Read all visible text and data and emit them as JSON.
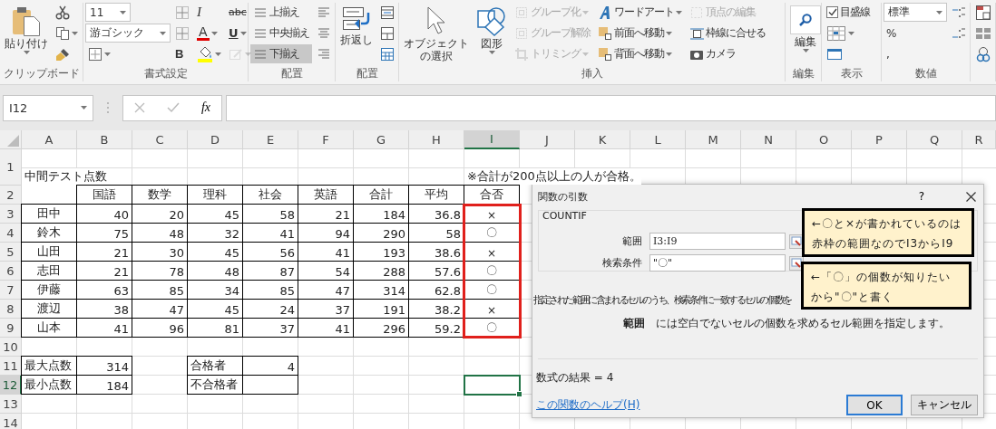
{
  "ribbon": {
    "groups": [
      {
        "label": "クリップボード",
        "columns": [
          [
            {
              "kind": "big",
              "text": "貼り付け"
            }
          ],
          [
            {
              "kind": "icon"
            },
            {
              "kind": "icon"
            },
            {
              "kind": "icon"
            }
          ]
        ]
      },
      {
        "label": "書式設定",
        "columns": [
          [
            {
              "kind": "combo",
              "text": "11"
            },
            {
              "kind": "combo",
              "text": "游ゴシック"
            },
            {
              "kind": "icon"
            }
          ],
          [
            {
              "kind": "icon"
            },
            {
              "kind": "icon"
            },
            {
              "kind": "glyph",
              "text": "B"
            }
          ],
          [
            {
              "kind": "glyph",
              "text": "I"
            },
            {
              "kind": "glyph",
              "text": "A"
            },
            {
              "kind": "icon"
            }
          ],
          [
            {
              "kind": "glyph",
              "text": "abc",
              "disabled": false
            },
            {
              "kind": "glyph",
              "text": "U",
              "disabled": false
            },
            {
              "kind": "icon",
              "disabled": true
            }
          ]
        ]
      },
      {
        "label": "配置",
        "columns": [
          [
            {
              "kind": "small",
              "text": "上揃え",
              "selected": false
            },
            {
              "kind": "small",
              "text": "中央揃え",
              "selected": false
            },
            {
              "kind": "small",
              "text": "下揃え",
              "selected": true
            }
          ],
          [
            {
              "kind": "icon"
            },
            {
              "kind": "icon"
            },
            {
              "kind": "icon"
            }
          ]
        ]
      },
      {
        "label": "配置",
        "columns": [
          [
            {
              "kind": "big",
              "text": "折返し"
            }
          ],
          [
            {
              "kind": "icon"
            },
            {
              "kind": "icon"
            },
            {
              "kind": "icon"
            }
          ]
        ]
      },
      {
        "label": "挿入",
        "columns": [
          [
            {
              "kind": "big",
              "text": "オブジェクトの選択"
            }
          ],
          [
            {
              "kind": "big",
              "text": "図形"
            }
          ],
          [
            {
              "kind": "small",
              "text": "グループ化",
              "disabled": true
            },
            {
              "kind": "small",
              "text": "グループ解除",
              "disabled": true
            },
            {
              "kind": "small",
              "text": "トリミング",
              "disabled": true
            }
          ],
          [
            {
              "kind": "small",
              "text": "ワードアート",
              "disabled": false
            },
            {
              "kind": "small",
              "text": "前面へ移動",
              "disabled": false
            },
            {
              "kind": "small",
              "text": "背面へ移動",
              "disabled": false
            }
          ],
          [
            {
              "kind": "small",
              "text": "頂点の編集",
              "disabled": true
            },
            {
              "kind": "small",
              "text": "枠線に合せる",
              "disabled": false
            },
            {
              "kind": "small",
              "text": "カメラ",
              "disabled": false
            }
          ]
        ]
      },
      {
        "label": "編集",
        "columns": [
          [
            {
              "kind": "big",
              "text": "編集"
            }
          ]
        ]
      },
      {
        "label": "表示",
        "columns": [
          [
            {
              "kind": "check",
              "text": "目盛線",
              "checked": true
            },
            {
              "kind": "icon"
            },
            {
              "kind": "icon"
            }
          ]
        ]
      },
      {
        "label": "数値",
        "columns": [
          [
            {
              "kind": "combo",
              "text": "標準"
            },
            {
              "kind": "glyph",
              "text": "%"
            },
            {
              "kind": "glyph",
              "text": ","
            }
          ],
          [
            {
              "kind": "icon"
            },
            {
              "kind": "icon"
            }
          ]
        ]
      },
      {
        "columns": [
          [
            {
              "kind": "icon"
            },
            {
              "kind": "icon"
            },
            {
              "kind": "icon"
            }
          ]
        ]
      }
    ]
  },
  "formula_bar": {
    "name_box": "I12",
    "fx": "fx"
  },
  "sheet": {
    "columns": [
      {
        "label": "A",
        "selected": false
      },
      {
        "label": "B",
        "selected": false
      },
      {
        "label": "C",
        "selected": false
      },
      {
        "label": "D",
        "selected": false
      },
      {
        "label": "E",
        "selected": false
      },
      {
        "label": "F",
        "selected": false
      },
      {
        "label": "G",
        "selected": false
      },
      {
        "label": "H",
        "selected": false
      },
      {
        "label": "I",
        "selected": true
      },
      {
        "label": "J",
        "selected": false
      },
      {
        "label": "K",
        "selected": false
      },
      {
        "label": "L",
        "selected": false
      },
      {
        "label": "M",
        "selected": false
      },
      {
        "label": "N",
        "selected": false
      },
      {
        "label": "O",
        "selected": false
      },
      {
        "label": "P",
        "selected": false
      },
      {
        "label": "Q",
        "selected": false
      },
      {
        "label": "R",
        "selected": false
      }
    ],
    "rows": [
      {
        "label": "1",
        "selected": false
      },
      {
        "label": "2",
        "selected": false
      },
      {
        "label": "3",
        "selected": false
      },
      {
        "label": "4",
        "selected": false
      },
      {
        "label": "5",
        "selected": false
      },
      {
        "label": "6",
        "selected": false
      },
      {
        "label": "7",
        "selected": false
      },
      {
        "label": "8",
        "selected": false
      },
      {
        "label": "9",
        "selected": false
      },
      {
        "label": "10",
        "selected": false
      },
      {
        "label": "11",
        "selected": false
      },
      {
        "label": "12",
        "selected": true
      },
      {
        "label": "13",
        "selected": false
      },
      {
        "label": "14",
        "selected": false
      }
    ],
    "title": "中間テスト点数",
    "note": "※合計が200点以上の人が合格。",
    "score_table": {
      "headers": [
        "国語",
        "数学",
        "理科",
        "社会",
        "英語",
        "合計",
        "平均",
        "合否"
      ],
      "rows": [
        {
          "name": "田中",
          "values": [
            "40",
            "20",
            "45",
            "58",
            "21",
            "184",
            "36.8"
          ],
          "result": "×"
        },
        {
          "name": "鈴木",
          "values": [
            "75",
            "48",
            "32",
            "41",
            "94",
            "290",
            "58"
          ],
          "result": "〇"
        },
        {
          "name": "山田",
          "values": [
            "21",
            "30",
            "45",
            "56",
            "41",
            "193",
            "38.6"
          ],
          "result": "×"
        },
        {
          "name": "志田",
          "values": [
            "21",
            "78",
            "48",
            "87",
            "54",
            "288",
            "57.6"
          ],
          "result": "〇"
        },
        {
          "name": "伊藤",
          "values": [
            "63",
            "85",
            "34",
            "85",
            "47",
            "314",
            "62.8"
          ],
          "result": "〇"
        },
        {
          "name": "渡辺",
          "values": [
            "38",
            "47",
            "45",
            "24",
            "37",
            "191",
            "38.2"
          ],
          "result": "×"
        },
        {
          "name": "山本",
          "values": [
            "41",
            "96",
            "81",
            "37",
            "41",
            "296",
            "59.2"
          ],
          "result": "〇"
        }
      ],
      "result_highlighted": true
    },
    "summaries": [
      {
        "rows": [
          {
            "label": "最大点数",
            "value": "314"
          },
          {
            "label": "最小点数",
            "value": "184"
          }
        ]
      },
      {
        "rows": [
          {
            "label": "合格者",
            "value": "4"
          },
          {
            "label": "不合格者"
          }
        ]
      }
    ]
  },
  "dialog": {
    "title": "関数の引数",
    "help": "?",
    "function": "COUNTIF",
    "args": [
      {
        "label": "範囲",
        "value": "I3:I9"
      },
      {
        "label": "検索条件",
        "value": "\"〇\""
      }
    ],
    "description": "指定された範囲に含まれるセルのうち、検索条件に一致するセルの個数を",
    "arg_help": "**範囲**　には空白でないセルの個数を求めるセル範囲を指定します。",
    "result": "数式の結果 =  4",
    "help_link": "この関数のヘルプ(H)",
    "buttons": [
      {
        "label": "OK",
        "default": true
      },
      {
        "label": "キャンセル",
        "default": false
      }
    ]
  },
  "callouts": [
    {
      "text": "←〇と×が書かれているのは赤枠の範囲なのでI3からI9"
    },
    {
      "text": "←「〇」の個数が知りたいから\"〇\"と書く"
    }
  ]
}
